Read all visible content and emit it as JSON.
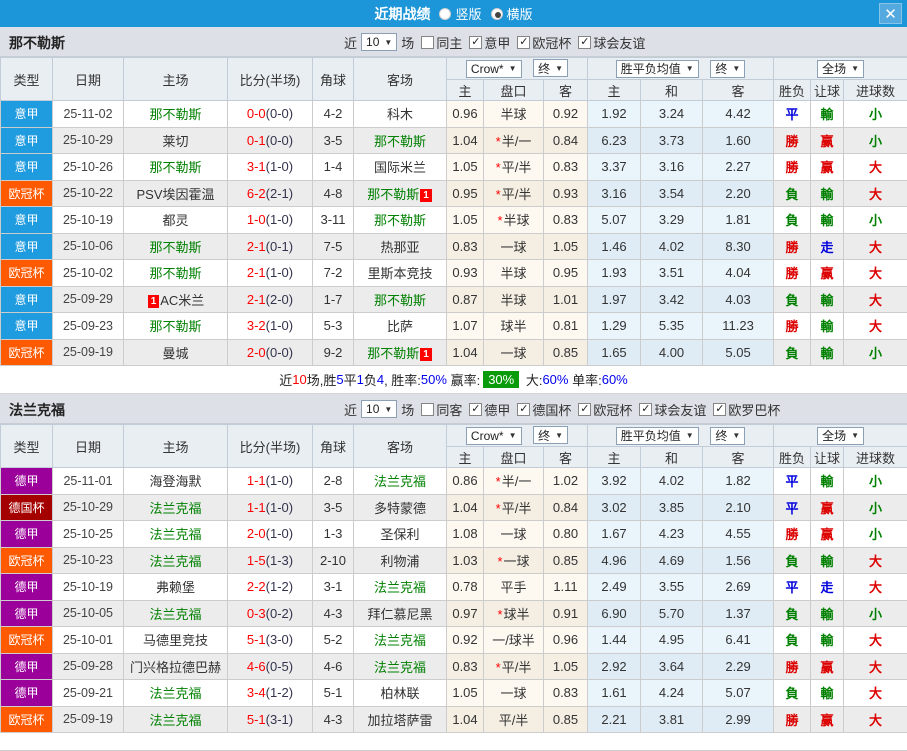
{
  "titlebar": {
    "title": "近期战绩",
    "radios": [
      {
        "label": "竖版",
        "selected": false
      },
      {
        "label": "横版",
        "selected": true
      }
    ],
    "close_glyph": "✕"
  },
  "columns": {
    "type": "类型",
    "date": "日期",
    "home": "主场",
    "score": "比分(半场)",
    "corners": "角球",
    "away": "客场",
    "odds_home": "主",
    "handicap": "盘口",
    "odds_away": "客",
    "avg_win": "主",
    "avg_draw": "和",
    "avg_lose": "客",
    "result": "胜负",
    "handicap_result": "让球",
    "goals": "进球数"
  },
  "selects": {
    "bookmaker": "Crow*",
    "final_a": "终",
    "avg": "胜平负均值",
    "final_b": "终",
    "scope": "全场"
  },
  "colors": {
    "topbar": "#1c96d9",
    "league": {
      "意甲": "#1f9be0",
      "欧冠杯": "#ff5a00",
      "德甲": "#9b009b",
      "德国杯": "#a40000"
    },
    "focal_team": "#008000",
    "score_red": "#ff0000",
    "win_red": "#dd0000",
    "draw_blue": "#0000dd",
    "loss_green": "#008000",
    "summary_highlight_bg": "#0a9b0a"
  },
  "sections": [
    {
      "team": "那不勒斯",
      "filter": {
        "near": "近",
        "count": "10",
        "games": "场",
        "checkboxes": [
          {
            "label": "同主",
            "checked": false
          },
          {
            "label": "意甲",
            "checked": true
          },
          {
            "label": "欧冠杯",
            "checked": true
          },
          {
            "label": "球会友谊",
            "checked": true
          }
        ]
      },
      "rows": [
        {
          "lg": "意甲",
          "date": "25-11-02",
          "home": "那不勒斯",
          "hf": true,
          "hb": "",
          "hbp": "",
          "sc": "0-0",
          "ht": "(0-0)",
          "cn": "4-2",
          "away": "科木",
          "af": false,
          "ab": "",
          "o1": "0.96",
          "pk": "半球",
          "st": false,
          "o2": "0.92",
          "aw": "1.92",
          "ad": "3.24",
          "al": "4.42",
          "r": "平",
          "rc": "blue",
          "hr": "輸",
          "hrc": "green",
          "g": "小",
          "gc": "green"
        },
        {
          "lg": "意甲",
          "date": "25-10-29",
          "home": "莱切",
          "hf": false,
          "hb": "",
          "hbp": "",
          "sc": "0-1",
          "ht": "(0-0)",
          "cn": "3-5",
          "away": "那不勒斯",
          "af": true,
          "ab": "",
          "o1": "1.04",
          "pk": "半/一",
          "st": true,
          "o2": "0.84",
          "aw": "6.23",
          "ad": "3.73",
          "al": "1.60",
          "r": "勝",
          "rc": "red",
          "hr": "赢",
          "hrc": "red",
          "g": "小",
          "gc": "green"
        },
        {
          "lg": "意甲",
          "date": "25-10-26",
          "home": "那不勒斯",
          "hf": true,
          "hb": "",
          "hbp": "",
          "sc": "3-1",
          "ht": "(1-0)",
          "cn": "1-4",
          "away": "国际米兰",
          "af": false,
          "ab": "",
          "o1": "1.05",
          "pk": "平/半",
          "st": true,
          "o2": "0.83",
          "aw": "3.37",
          "ad": "3.16",
          "al": "2.27",
          "r": "勝",
          "rc": "red",
          "hr": "赢",
          "hrc": "red",
          "g": "大",
          "gc": "red"
        },
        {
          "lg": "欧冠杯",
          "date": "25-10-22",
          "home": "PSV埃因霍温",
          "hf": false,
          "hb": "",
          "hbp": "",
          "sc": "6-2",
          "ht": "(2-1)",
          "cn": "4-8",
          "away": "那不勒斯",
          "af": true,
          "ab": "1",
          "o1": "0.95",
          "pk": "平/半",
          "st": true,
          "o2": "0.93",
          "aw": "3.16",
          "ad": "3.54",
          "al": "2.20",
          "r": "負",
          "rc": "green",
          "hr": "輸",
          "hrc": "green",
          "g": "大",
          "gc": "red"
        },
        {
          "lg": "意甲",
          "date": "25-10-19",
          "home": "都灵",
          "hf": false,
          "hb": "",
          "hbp": "",
          "sc": "1-0",
          "ht": "(1-0)",
          "cn": "3-11",
          "away": "那不勒斯",
          "af": true,
          "ab": "",
          "o1": "1.05",
          "pk": "半球",
          "st": true,
          "o2": "0.83",
          "aw": "5.07",
          "ad": "3.29",
          "al": "1.81",
          "r": "負",
          "rc": "green",
          "hr": "輸",
          "hrc": "green",
          "g": "小",
          "gc": "green"
        },
        {
          "lg": "意甲",
          "date": "25-10-06",
          "home": "那不勒斯",
          "hf": true,
          "hb": "",
          "hbp": "",
          "sc": "2-1",
          "ht": "(0-1)",
          "cn": "7-5",
          "away": "热那亚",
          "af": false,
          "ab": "",
          "o1": "0.83",
          "pk": "一球",
          "st": false,
          "o2": "1.05",
          "aw": "1.46",
          "ad": "4.02",
          "al": "8.30",
          "r": "勝",
          "rc": "red",
          "hr": "走",
          "hrc": "blue",
          "g": "大",
          "gc": "red"
        },
        {
          "lg": "欧冠杯",
          "date": "25-10-02",
          "home": "那不勒斯",
          "hf": true,
          "hb": "",
          "hbp": "",
          "sc": "2-1",
          "ht": "(1-0)",
          "cn": "7-2",
          "away": "里斯本竞技",
          "af": false,
          "ab": "",
          "o1": "0.93",
          "pk": "半球",
          "st": false,
          "o2": "0.95",
          "aw": "1.93",
          "ad": "3.51",
          "al": "4.04",
          "r": "勝",
          "rc": "red",
          "hr": "赢",
          "hrc": "red",
          "g": "大",
          "gc": "red"
        },
        {
          "lg": "意甲",
          "date": "25-09-29",
          "home": "AC米兰",
          "hf": false,
          "hb": "1",
          "hbp": "before",
          "sc": "2-1",
          "ht": "(2-0)",
          "cn": "1-7",
          "away": "那不勒斯",
          "af": true,
          "ab": "",
          "o1": "0.87",
          "pk": "半球",
          "st": false,
          "o2": "1.01",
          "aw": "1.97",
          "ad": "3.42",
          "al": "4.03",
          "r": "負",
          "rc": "green",
          "hr": "輸",
          "hrc": "green",
          "g": "大",
          "gc": "red"
        },
        {
          "lg": "意甲",
          "date": "25-09-23",
          "home": "那不勒斯",
          "hf": true,
          "hb": "",
          "hbp": "",
          "sc": "3-2",
          "ht": "(1-0)",
          "cn": "5-3",
          "away": "比萨",
          "af": false,
          "ab": "",
          "o1": "1.07",
          "pk": "球半",
          "st": false,
          "o2": "0.81",
          "aw": "1.29",
          "ad": "5.35",
          "al": "11.23",
          "r": "勝",
          "rc": "red",
          "hr": "輸",
          "hrc": "green",
          "g": "大",
          "gc": "red"
        },
        {
          "lg": "欧冠杯",
          "date": "25-09-19",
          "home": "曼城",
          "hf": false,
          "hb": "",
          "hbp": "",
          "sc": "2-0",
          "ht": "(0-0)",
          "cn": "9-2",
          "away": "那不勒斯",
          "af": true,
          "ab": "1",
          "o1": "1.04",
          "pk": "一球",
          "st": false,
          "o2": "0.85",
          "aw": "1.65",
          "ad": "4.00",
          "al": "5.05",
          "r": "負",
          "rc": "green",
          "hr": "輸",
          "hrc": "green",
          "g": "小",
          "gc": "green"
        }
      ],
      "summary": [
        {
          "t": "近",
          "s": "k"
        },
        {
          "t": "10",
          "s": "r"
        },
        {
          "t": "场,胜",
          "s": "k"
        },
        {
          "t": "5",
          "s": "b"
        },
        {
          "t": "平",
          "s": "k"
        },
        {
          "t": "1",
          "s": "b"
        },
        {
          "t": "负",
          "s": "k"
        },
        {
          "t": "4",
          "s": "b"
        },
        {
          "t": ", 胜率:",
          "s": "k"
        },
        {
          "t": "50%",
          "s": "b"
        },
        {
          "t": " 赢率:",
          "s": "k"
        },
        {
          "t": "30%",
          "s": "g"
        },
        {
          "t": " 大:",
          "s": "k"
        },
        {
          "t": "60%",
          "s": "b"
        },
        {
          "t": " 单率:",
          "s": "k"
        },
        {
          "t": "60%",
          "s": "b"
        }
      ]
    },
    {
      "team": "法兰克福",
      "filter": {
        "near": "近",
        "count": "10",
        "games": "场",
        "checkboxes": [
          {
            "label": "同客",
            "checked": false
          },
          {
            "label": "德甲",
            "checked": true
          },
          {
            "label": "德国杯",
            "checked": true
          },
          {
            "label": "欧冠杯",
            "checked": true
          },
          {
            "label": "球会友谊",
            "checked": true
          },
          {
            "label": "欧罗巴杯",
            "checked": true
          }
        ]
      },
      "rows": [
        {
          "lg": "德甲",
          "date": "25-11-01",
          "home": "海登海默",
          "hf": false,
          "hb": "",
          "hbp": "",
          "sc": "1-1",
          "ht": "(1-0)",
          "cn": "2-8",
          "away": "法兰克福",
          "af": true,
          "ab": "",
          "o1": "0.86",
          "pk": "半/一",
          "st": true,
          "o2": "1.02",
          "aw": "3.92",
          "ad": "4.02",
          "al": "1.82",
          "r": "平",
          "rc": "blue",
          "hr": "輸",
          "hrc": "green",
          "g": "小",
          "gc": "green"
        },
        {
          "lg": "德国杯",
          "date": "25-10-29",
          "home": "法兰克福",
          "hf": true,
          "hb": "",
          "hbp": "",
          "sc": "1-1",
          "ht": "(1-0)",
          "cn": "3-5",
          "away": "多特蒙德",
          "af": false,
          "ab": "",
          "o1": "1.04",
          "pk": "平/半",
          "st": true,
          "o2": "0.84",
          "aw": "3.02",
          "ad": "3.85",
          "al": "2.10",
          "r": "平",
          "rc": "blue",
          "hr": "赢",
          "hrc": "red",
          "g": "小",
          "gc": "green"
        },
        {
          "lg": "德甲",
          "date": "25-10-25",
          "home": "法兰克福",
          "hf": true,
          "hb": "",
          "hbp": "",
          "sc": "2-0",
          "ht": "(1-0)",
          "cn": "1-3",
          "away": "圣保利",
          "af": false,
          "ab": "",
          "o1": "1.08",
          "pk": "一球",
          "st": false,
          "o2": "0.80",
          "aw": "1.67",
          "ad": "4.23",
          "al": "4.55",
          "r": "勝",
          "rc": "red",
          "hr": "赢",
          "hrc": "red",
          "g": "小",
          "gc": "green"
        },
        {
          "lg": "欧冠杯",
          "date": "25-10-23",
          "home": "法兰克福",
          "hf": true,
          "hb": "",
          "hbp": "",
          "sc": "1-5",
          "ht": "(1-3)",
          "cn": "2-10",
          "away": "利物浦",
          "af": false,
          "ab": "",
          "o1": "1.03",
          "pk": "一球",
          "st": true,
          "o2": "0.85",
          "aw": "4.96",
          "ad": "4.69",
          "al": "1.56",
          "r": "負",
          "rc": "green",
          "hr": "輸",
          "hrc": "green",
          "g": "大",
          "gc": "red"
        },
        {
          "lg": "德甲",
          "date": "25-10-19",
          "home": "弗赖堡",
          "hf": false,
          "hb": "",
          "hbp": "",
          "sc": "2-2",
          "ht": "(1-2)",
          "cn": "3-1",
          "away": "法兰克福",
          "af": true,
          "ab": "",
          "o1": "0.78",
          "pk": "平手",
          "st": false,
          "o2": "1.11",
          "aw": "2.49",
          "ad": "3.55",
          "al": "2.69",
          "r": "平",
          "rc": "blue",
          "hr": "走",
          "hrc": "blue",
          "g": "大",
          "gc": "red"
        },
        {
          "lg": "德甲",
          "date": "25-10-05",
          "home": "法兰克福",
          "hf": true,
          "hb": "",
          "hbp": "",
          "sc": "0-3",
          "ht": "(0-2)",
          "cn": "4-3",
          "away": "拜仁慕尼黑",
          "af": false,
          "ab": "",
          "o1": "0.97",
          "pk": "球半",
          "st": true,
          "o2": "0.91",
          "aw": "6.90",
          "ad": "5.70",
          "al": "1.37",
          "r": "負",
          "rc": "green",
          "hr": "輸",
          "hrc": "green",
          "g": "小",
          "gc": "green"
        },
        {
          "lg": "欧冠杯",
          "date": "25-10-01",
          "home": "马德里竞技",
          "hf": false,
          "hb": "",
          "hbp": "",
          "sc": "5-1",
          "ht": "(3-0)",
          "cn": "5-2",
          "away": "法兰克福",
          "af": true,
          "ab": "",
          "o1": "0.92",
          "pk": "一/球半",
          "st": false,
          "o2": "0.96",
          "aw": "1.44",
          "ad": "4.95",
          "al": "6.41",
          "r": "負",
          "rc": "green",
          "hr": "輸",
          "hrc": "green",
          "g": "大",
          "gc": "red"
        },
        {
          "lg": "德甲",
          "date": "25-09-28",
          "home": "门兴格拉德巴赫",
          "hf": false,
          "hb": "",
          "hbp": "",
          "sc": "4-6",
          "ht": "(0-5)",
          "cn": "4-6",
          "away": "法兰克福",
          "af": true,
          "ab": "",
          "o1": "0.83",
          "pk": "平/半",
          "st": true,
          "o2": "1.05",
          "aw": "2.92",
          "ad": "3.64",
          "al": "2.29",
          "r": "勝",
          "rc": "red",
          "hr": "赢",
          "hrc": "red",
          "g": "大",
          "gc": "red"
        },
        {
          "lg": "德甲",
          "date": "25-09-21",
          "home": "法兰克福",
          "hf": true,
          "hb": "",
          "hbp": "",
          "sc": "3-4",
          "ht": "(1-2)",
          "cn": "5-1",
          "away": "柏林联",
          "af": false,
          "ab": "",
          "o1": "1.05",
          "pk": "一球",
          "st": false,
          "o2": "0.83",
          "aw": "1.61",
          "ad": "4.24",
          "al": "5.07",
          "r": "負",
          "rc": "green",
          "hr": "輸",
          "hrc": "green",
          "g": "大",
          "gc": "red"
        },
        {
          "lg": "欧冠杯",
          "date": "25-09-19",
          "home": "法兰克福",
          "hf": true,
          "hb": "",
          "hbp": "",
          "sc": "5-1",
          "ht": "(3-1)",
          "cn": "4-3",
          "away": "加拉塔萨雷",
          "af": false,
          "ab": "",
          "o1": "1.04",
          "pk": "平/半",
          "st": false,
          "o2": "0.85",
          "aw": "2.21",
          "ad": "3.81",
          "al": "2.99",
          "r": "勝",
          "rc": "red",
          "hr": "赢",
          "hrc": "red",
          "g": "大",
          "gc": "red"
        }
      ],
      "summary": null
    }
  ]
}
